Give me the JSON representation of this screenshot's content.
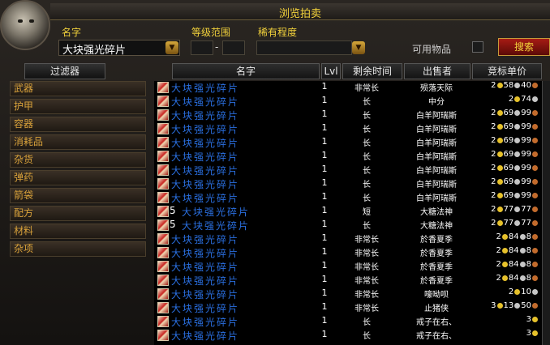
{
  "title": "浏览拍卖",
  "labels": {
    "name": "名字",
    "level_range": "等级范围",
    "rarity": "稀有程度",
    "usable": "可用物品",
    "level_separator": "-"
  },
  "search": {
    "value": "大块强光碎片",
    "button": "搜索"
  },
  "filter_tab": "过滤器",
  "filters": [
    "武器",
    "护甲",
    "容器",
    "消耗品",
    "杂货",
    "弹药",
    "箭袋",
    "配方",
    "材料",
    "杂项"
  ],
  "columns": {
    "name": "名字",
    "lvl": "Lvl",
    "time": "剩余时间",
    "seller": "出售者",
    "bid": "竞标单价"
  },
  "rows": [
    {
      "count": "",
      "name": "大块强光碎片",
      "lvl": "1",
      "time": "非常长",
      "seller": "殒落天际",
      "price": "2●58●40●"
    },
    {
      "count": "",
      "name": "大块强光碎片",
      "lvl": "1",
      "time": "长",
      "seller": "中分",
      "price": "2●74●"
    },
    {
      "count": "",
      "name": "大块强光碎片",
      "lvl": "1",
      "time": "长",
      "seller": "白羊阿瑞斯",
      "price": "2●69●99●"
    },
    {
      "count": "",
      "name": "大块强光碎片",
      "lvl": "1",
      "time": "长",
      "seller": "白羊阿瑞斯",
      "price": "2●69●99●"
    },
    {
      "count": "",
      "name": "大块强光碎片",
      "lvl": "1",
      "time": "长",
      "seller": "白羊阿瑞斯",
      "price": "2●69●99●"
    },
    {
      "count": "",
      "name": "大块强光碎片",
      "lvl": "1",
      "time": "长",
      "seller": "白羊阿瑞斯",
      "price": "2●69●99●"
    },
    {
      "count": "",
      "name": "大块强光碎片",
      "lvl": "1",
      "time": "长",
      "seller": "白羊阿瑞斯",
      "price": "2●69●99●"
    },
    {
      "count": "",
      "name": "大块强光碎片",
      "lvl": "1",
      "time": "长",
      "seller": "白羊阿瑞斯",
      "price": "2●69●99●"
    },
    {
      "count": "",
      "name": "大块强光碎片",
      "lvl": "1",
      "time": "长",
      "seller": "白羊阿瑞斯",
      "price": "2●69●99●"
    },
    {
      "count": "5",
      "name": "大块强光碎片",
      "lvl": "1",
      "time": "短",
      "seller": "大糖法神",
      "price": "2●77●77●"
    },
    {
      "count": "5",
      "name": "大块强光碎片",
      "lvl": "1",
      "time": "长",
      "seller": "大糖法神",
      "price": "2●77●77●"
    },
    {
      "count": "",
      "name": "大块强光碎片",
      "lvl": "1",
      "time": "非常长",
      "seller": "於香夏季",
      "price": "2●84●8●"
    },
    {
      "count": "",
      "name": "大块强光碎片",
      "lvl": "1",
      "time": "非常长",
      "seller": "於香夏季",
      "price": "2●84●8●"
    },
    {
      "count": "",
      "name": "大块强光碎片",
      "lvl": "1",
      "time": "非常长",
      "seller": "於香夏季",
      "price": "2●84●8●"
    },
    {
      "count": "",
      "name": "大块强光碎片",
      "lvl": "1",
      "time": "非常长",
      "seller": "於香夏季",
      "price": "2●84●8●"
    },
    {
      "count": "",
      "name": "大块强光碎片",
      "lvl": "1",
      "time": "非常长",
      "seller": "嚎呦呗",
      "price": "2●10●"
    },
    {
      "count": "",
      "name": "大块强光碎片",
      "lvl": "1",
      "time": "非常长",
      "seller": "止猪侠",
      "price": "3●13●50●"
    },
    {
      "count": "",
      "name": "大块强光碎片",
      "lvl": "1",
      "time": "长",
      "seller": "戒子在右、",
      "price": "3●"
    },
    {
      "count": "",
      "name": "大块强光碎片",
      "lvl": "1",
      "time": "长",
      "seller": "戒子在右、",
      "price": "3●"
    }
  ],
  "coin_colors": {
    "gold": "#e6c12b",
    "silver": "#c6c6c6",
    "copper": "#c26b2c"
  }
}
